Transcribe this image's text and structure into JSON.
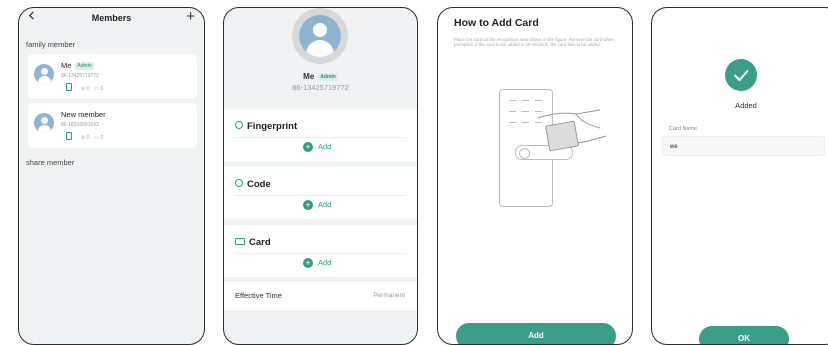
{
  "colors": {
    "accent": "#3a9e88",
    "badge_bg": "#dcefe8",
    "panel_bg": "#f1f2f4"
  },
  "members_screen": {
    "title": "Members",
    "add_icon": "plus-icon",
    "back_icon": "chevron-left-icon",
    "family_label": "family member",
    "members": [
      {
        "name": "Me",
        "badge": "Admin",
        "phone": "86-13425719772",
        "count_a": "0",
        "count_b": "0"
      },
      {
        "name": "New member",
        "phone": "86-18316591593",
        "count_a": "0",
        "count_b": "0"
      }
    ],
    "share_label": "share member"
  },
  "member_detail": {
    "name": "Me",
    "badge": "Admin",
    "phone": "86-13425719772",
    "sections": [
      {
        "title": "Fingerprint",
        "icon": "fingerprint-icon",
        "add_label": "Add"
      },
      {
        "title": "Code",
        "icon": "code-icon",
        "add_label": "Add"
      },
      {
        "title": "Card",
        "icon": "card-icon",
        "add_label": "Add"
      }
    ],
    "effective_time_label": "Effective Time",
    "effective_time_value": "Permanent"
  },
  "add_card_screen": {
    "title": "How to Add Card",
    "description": "Place the card on the recognition area shown in the figure. Remove the card when prompted. If the card is not added in 30 seconds, the card fails to be added.",
    "button_label": "Add"
  },
  "added_screen": {
    "status": "Added",
    "card_name_label": "Card Name",
    "card_name_value": "we",
    "button_label": "OK"
  }
}
